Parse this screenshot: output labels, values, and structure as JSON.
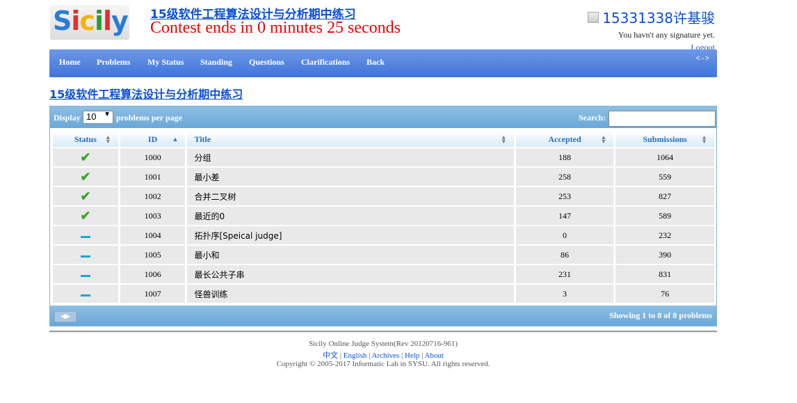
{
  "header": {
    "logo_letters": [
      "S",
      "i",
      "c",
      "i",
      "l",
      "y"
    ],
    "logo_colors": [
      "#2a7bd8",
      "#e03030",
      "#f2b400",
      "#2a9a3a",
      "#e03030",
      "#2a7bd8"
    ],
    "contest_title": "15级软件工程算法设计与分析期中练习",
    "countdown": "Contest ends in 0 minutes 25 seconds"
  },
  "user": {
    "name": "15331338许基骏",
    "signature": "You havn't any signature yet.",
    "logout": "Logout"
  },
  "nav": {
    "items": [
      "Home",
      "Problems",
      "My Status",
      "Standing",
      "Questions",
      "Clarifications",
      "Back"
    ],
    "toggle": "<->"
  },
  "page_title": "15级软件工程算法设计与分析期中练习",
  "toolbar": {
    "display_label": "Display",
    "page_size": "10",
    "per_page_label": "problems per page",
    "search_label": "Search:"
  },
  "table": {
    "headers": [
      "Status",
      "ID",
      "Title",
      "Accepted",
      "Submissions"
    ],
    "rows": [
      {
        "status": "accepted",
        "id": "1000",
        "title": "分组",
        "accepted": "188",
        "submissions": "1064"
      },
      {
        "status": "accepted",
        "id": "1001",
        "title": "最小差",
        "accepted": "258",
        "submissions": "559"
      },
      {
        "status": "accepted",
        "id": "1002",
        "title": "合并二叉树",
        "accepted": "253",
        "submissions": "827"
      },
      {
        "status": "accepted",
        "id": "1003",
        "title": "最近的0",
        "accepted": "147",
        "submissions": "589"
      },
      {
        "status": "none",
        "id": "1004",
        "title": "拓扑序[Speical judge]",
        "accepted": "0",
        "submissions": "232"
      },
      {
        "status": "none",
        "id": "1005",
        "title": "最小和",
        "accepted": "86",
        "submissions": "390"
      },
      {
        "status": "none",
        "id": "1006",
        "title": "最长公共子串",
        "accepted": "231",
        "submissions": "831"
      },
      {
        "status": "none",
        "id": "1007",
        "title": "怪兽训练",
        "accepted": "3",
        "submissions": "76"
      }
    ],
    "showing": "Showing 1 to 8 of 8 problems"
  },
  "footer": {
    "system": "Sicily Online Judge System(Rev 20120716-961)",
    "links": [
      "中文",
      "English",
      "Archives",
      "Help",
      "About"
    ],
    "copyright": "Copyright © 2005-2017 Informatic Lab in SYSU. All rights reserved."
  },
  "colors": {
    "link": "#0b4fd6",
    "countdown": "#ee0000",
    "accepted_check": "#3aa42e",
    "status_dash": "#1aa5d8"
  },
  "icons": {
    "accepted": "checkmark-icon",
    "not_attempted": "dash-icon"
  }
}
